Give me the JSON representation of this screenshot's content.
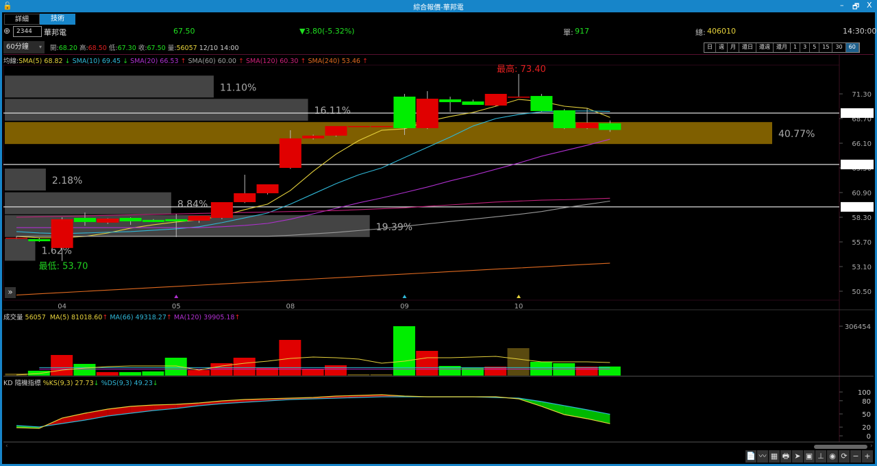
{
  "window": {
    "title": "綜合報價-華邦電",
    "minimize": "–",
    "restore": "🗗",
    "close": "X"
  },
  "tabs": [
    "詳細",
    "技術"
  ],
  "quote": {
    "code": "2344",
    "name": "華邦電",
    "price": "67.50",
    "change": "▼3.80(-5.32%)",
    "single_label": "單:",
    "single": "917",
    "total_label": "總:",
    "total": "406010",
    "time": "14:30:00"
  },
  "ohlc": {
    "interval": "60分鐘",
    "open_label": "開:",
    "open": "68.20",
    "high_label": "高:",
    "high": "68.50",
    "low_label": "低:",
    "low": "67.30",
    "close_label": "收:",
    "close": "67.50",
    "vol_label": "量:",
    "vol": "56057",
    "datetime": "12/10 14:00"
  },
  "periods": [
    "日",
    "週",
    "月",
    "還日",
    "還週",
    "還月",
    "1",
    "3",
    "5",
    "15",
    "30",
    "60"
  ],
  "selected_period": "60",
  "ma_legend": {
    "prefix": "均線:",
    "items": [
      {
        "text": "SMA(5) 68.82",
        "arrow": "↓",
        "color": "#e6d23c",
        "arrow_color": "#20d020"
      },
      {
        "text": "SMA(10) 69.45",
        "arrow": "↓",
        "color": "#30b8d8",
        "arrow_color": "#20d020"
      },
      {
        "text": "SMA(20) 66.53",
        "arrow": "↑",
        "color": "#b030d0",
        "arrow_color": "#e02020"
      },
      {
        "text": "SMA(60) 60.00",
        "arrow": "↑",
        "color": "#a0a0a0",
        "arrow_color": "#e02020"
      },
      {
        "text": "SMA(120) 60.30",
        "arrow": "↑",
        "color": "#d0207a",
        "arrow_color": "#e02020"
      },
      {
        "text": "SMA(240) 53.46",
        "arrow": "↑",
        "color": "#e06a20",
        "arrow_color": "#e02020"
      }
    ]
  },
  "colors": {
    "up": "#e00000",
    "down": "#00ee00",
    "gold": "#7f5f00",
    "profile": "#444444"
  },
  "chart_data": {
    "type": "candlestick",
    "price_axis": {
      "ticks": [
        "71.30",
        "68.70",
        "66.10",
        "63.50",
        "60.90",
        "58.30",
        "55.70",
        "53.10",
        "50.50"
      ],
      "range": [
        50.5,
        71.3
      ]
    },
    "x_labels": [
      {
        "bar": 2,
        "text": "04"
      },
      {
        "bar": 7,
        "text": "05"
      },
      {
        "bar": 12,
        "text": "08"
      },
      {
        "bar": 17,
        "text": "09"
      },
      {
        "bar": 22,
        "text": "10"
      }
    ],
    "markers": [
      {
        "bar": 7,
        "color": "#b030d0"
      },
      {
        "bar": 17,
        "color": "#30b8d8"
      },
      {
        "bar": 22,
        "color": "#e6d23c"
      }
    ],
    "ohlc": [
      [
        56.14,
        56.3,
        56.0,
        56.14
      ],
      [
        55.99,
        56.1,
        55.7,
        55.77
      ],
      [
        55.06,
        58.3,
        53.7,
        58.09
      ],
      [
        58.23,
        58.8,
        57.4,
        57.8
      ],
      [
        57.73,
        58.2,
        57.6,
        58.16
      ],
      [
        58.23,
        58.3,
        57.5,
        57.87
      ],
      [
        58.02,
        58.1,
        57.8,
        57.8
      ],
      [
        58.09,
        58.66,
        56.21,
        57.87
      ],
      [
        57.94,
        58.2,
        57.7,
        58.45
      ],
      [
        58.23,
        58.6,
        58.1,
        59.89
      ],
      [
        59.89,
        62.78,
        59.8,
        60.83
      ],
      [
        60.83,
        61.2,
        60.7,
        61.77
      ],
      [
        63.5,
        67.47,
        63.4,
        66.61
      ],
      [
        66.61,
        67.0,
        66.5,
        66.9
      ],
      [
        66.9,
        67.9,
        66.8,
        67.91
      ],
      [
        67.91,
        67.91,
        67.91,
        67.91
      ],
      [
        67.91,
        67.91,
        67.91,
        67.91
      ],
      [
        71.01,
        71.3,
        66.97,
        67.69
      ],
      [
        67.69,
        71.59,
        67.6,
        70.79
      ],
      [
        70.72,
        71.0,
        69.4,
        70.43
      ],
      [
        70.5,
        70.7,
        70.3,
        70.14
      ],
      [
        70.07,
        71.3,
        70.0,
        71.3
      ],
      [
        71.01,
        73.4,
        71.0,
        71.01
      ],
      [
        71.08,
        71.3,
        69.4,
        69.49
      ],
      [
        69.57,
        69.7,
        67.6,
        67.69
      ],
      [
        67.69,
        69.78,
        67.6,
        68.27
      ],
      [
        68.2,
        68.5,
        67.3,
        67.5
      ]
    ],
    "ma": [
      {
        "name": "SMA(5)",
        "color": "#e6d23c",
        "values": [
          56.28,
          56.14,
          56.14,
          56.28,
          56.64,
          57.15,
          57.51,
          57.8,
          58.02,
          58.45,
          59.1,
          59.68,
          61.12,
          63.14,
          64.95,
          66.39,
          67.47,
          67.62,
          68.41,
          68.92,
          69.35,
          70.0,
          70.72,
          70.5,
          70.0,
          69.78,
          68.82
        ]
      },
      {
        "name": "SMA(10)",
        "color": "#30b8d8",
        "values": [
          56.79,
          56.64,
          56.57,
          56.64,
          56.72,
          56.79,
          56.93,
          57.08,
          57.3,
          57.73,
          58.23,
          58.74,
          59.68,
          60.76,
          61.84,
          62.78,
          63.5,
          64.59,
          65.67,
          66.75,
          67.91,
          68.7,
          69.13,
          69.42,
          69.5,
          69.5,
          69.45
        ]
      },
      {
        "name": "SMA(20)",
        "color": "#b030d0",
        "values": [
          57.2,
          57.2,
          57.2,
          57.2,
          57.2,
          57.2,
          57.2,
          57.2,
          57.2,
          57.3,
          57.44,
          57.65,
          58.09,
          58.66,
          59.24,
          59.82,
          60.33,
          60.9,
          61.48,
          62.13,
          62.71,
          63.36,
          64.01,
          64.73,
          65.31,
          65.89,
          66.53
        ]
      },
      {
        "name": "SMA(60)",
        "color": "#9a9a9a",
        "values": [
          56.3,
          56.3,
          56.3,
          56.3,
          56.3,
          56.3,
          56.3,
          56.3,
          56.3,
          56.3,
          56.3,
          56.3,
          56.4,
          56.55,
          56.7,
          56.9,
          57.1,
          57.35,
          57.6,
          57.85,
          58.1,
          58.35,
          58.6,
          58.9,
          59.3,
          59.65,
          60.0
        ]
      },
      {
        "name": "SMA(120)",
        "color": "#c0207a",
        "values": [
          58.3,
          58.35,
          58.4,
          58.45,
          58.5,
          58.55,
          58.6,
          58.65,
          58.7,
          58.75,
          58.8,
          58.85,
          58.9,
          58.95,
          59.0,
          59.1,
          59.2,
          59.3,
          59.45,
          59.6,
          59.75,
          59.9,
          60.0,
          60.1,
          60.15,
          60.22,
          60.3
        ]
      },
      {
        "name": "SMA(240)",
        "color": "#e06a20",
        "values": [
          50.1,
          50.23,
          50.36,
          50.49,
          50.62,
          50.75,
          50.88,
          51.01,
          51.14,
          51.27,
          51.4,
          51.53,
          51.66,
          51.79,
          51.92,
          52.05,
          52.18,
          52.31,
          52.44,
          52.57,
          52.7,
          52.83,
          52.95,
          53.08,
          53.21,
          53.34,
          53.46
        ]
      }
    ],
    "levels": [
      69.28,
      63.86,
      59.39
    ],
    "volume_profile": [
      {
        "price_high": 73.3,
        "pct": 11.1,
        "label": "11.10%"
      },
      {
        "price_high": 70.85,
        "pct": 16.11,
        "label": "16.11%"
      },
      {
        "price_high": 68.4,
        "pct": 40.77,
        "label": "40.77%",
        "highlight": true
      },
      {
        "price_high": 63.5,
        "pct": 2.18,
        "label": "2.18%"
      },
      {
        "price_high": 61.0,
        "pct": 8.84,
        "label": "8.84%"
      },
      {
        "price_high": 58.6,
        "pct": 19.39,
        "label": "19.39%"
      },
      {
        "price_high": 56.1,
        "pct": 1.62,
        "label": "1.62%"
      }
    ],
    "extremes": {
      "high_label": "最高: 73.40",
      "high_bar": 22,
      "high": 73.4,
      "low_label": "最低: 53.70",
      "low_bar": 2,
      "low": 53.7
    },
    "volume": {
      "legend": {
        "title": "成交量",
        "value": "56057",
        "ma5": "MA(5) 81018.60",
        "ma66": "MA(66) 49318.27",
        "ma120": "MA(120) 39905.18",
        "arrow": "↑"
      },
      "axis_max_label": "306454",
      "axis_max": 306454,
      "values": [
        12800,
        29800,
        127700,
        72400,
        21300,
        21300,
        25500,
        110700,
        34000,
        76600,
        110700,
        46800,
        221300,
        42600,
        63800,
        8500,
        8500,
        306454,
        153200,
        59600,
        46800,
        55300,
        170200,
        85100,
        76600,
        55300,
        56057
      ],
      "ma5": [
        4256,
        12768,
        34048,
        46816,
        55328,
        59584,
        59584,
        59584,
        34048,
        59584,
        76608,
        89376,
        106400,
        114912,
        110656,
        102144,
        76608,
        89376,
        110656,
        110656,
        114912,
        119168,
        102144,
        85120,
        85120,
        85120,
        81018
      ],
      "ma66": 49318.27,
      "ma120": 39905.18
    },
    "kd": {
      "legend": {
        "title": "KD 隨機指標",
        "k": "%KS(9,3) 27.73",
        "d": "%DS(9,3) 49.23",
        "arrow": "↓"
      },
      "ticks": [
        "100",
        "80",
        "50",
        "20",
        "0"
      ],
      "k": [
        18.8,
        17.2,
        40.6,
        51.6,
        60.9,
        67.2,
        70.3,
        71.9,
        75,
        79.7,
        82.8,
        84.4,
        85.9,
        87.5,
        90.6,
        92.2,
        93.8,
        90.6,
        89.1,
        89.1,
        89.1,
        89.1,
        84.4,
        67.2,
        48.4,
        39.1,
        27.73
      ],
      "d": [
        23.4,
        20.3,
        28.1,
        35.9,
        45.3,
        51.6,
        57.8,
        62.5,
        68.8,
        73.4,
        76.6,
        79.7,
        82.8,
        84.4,
        85.9,
        87.5,
        89.1,
        89.1,
        89.1,
        89.1,
        89.1,
        87.5,
        85.9,
        78.1,
        68.8,
        59.4,
        49.23
      ]
    }
  },
  "toolbar": [
    "📄",
    "〰",
    "▦",
    "🖶",
    "➤",
    "▣",
    "⊥",
    "◉",
    "⟳",
    "−",
    "+"
  ],
  "expand_icon": "»"
}
